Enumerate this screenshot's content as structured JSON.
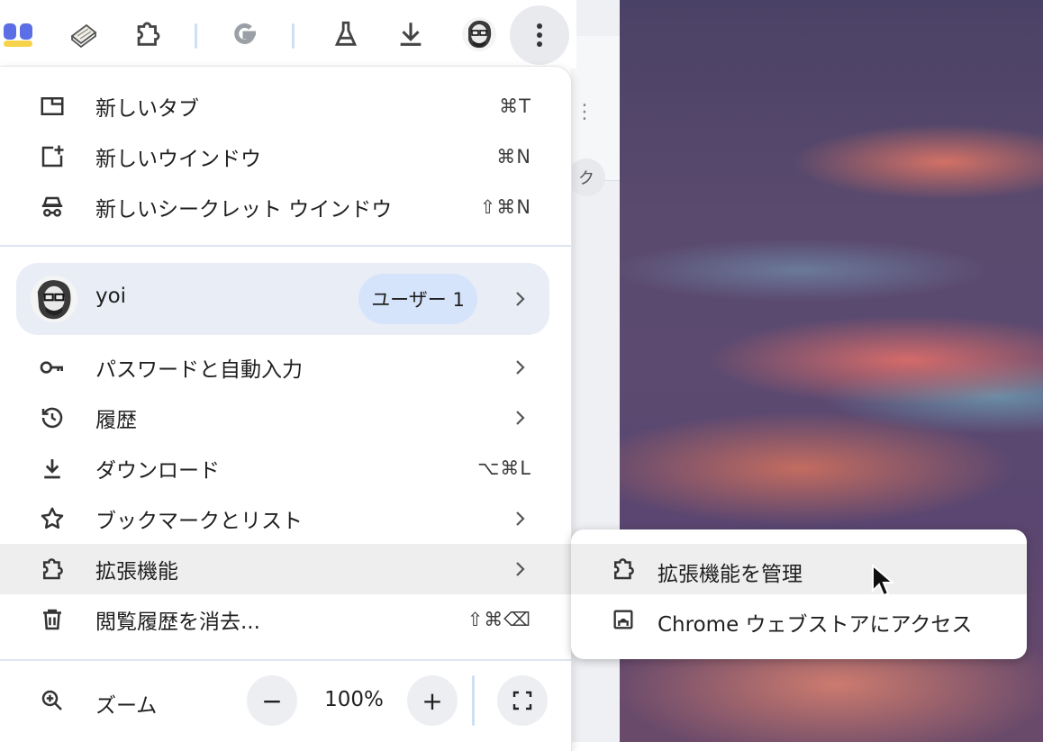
{
  "colors": {
    "accent": "#d5e4fb",
    "profile_bg": "#e9edf6",
    "highlight": "#eeeeee",
    "divider": "#dde5f0"
  },
  "background_strip": {
    "partial_text": "ク"
  },
  "toolbar": {
    "icons": [
      "extension-icon-blue",
      "extension-icon-notebook",
      "extensions-puzzle-icon",
      "google-g-icon",
      "labs-flask-icon",
      "downloads-icon",
      "profile-avatar-icon",
      "more-vert-icon"
    ]
  },
  "menu": {
    "new_tab": {
      "label": "新しいタブ",
      "shortcut": "⌘T",
      "icon": "new-tab-icon"
    },
    "new_window": {
      "label": "新しいウインドウ",
      "shortcut": "⌘N",
      "icon": "new-window-icon"
    },
    "new_incognito": {
      "label": "新しいシークレット ウインドウ",
      "shortcut": "⇧⌘N",
      "icon": "incognito-icon"
    },
    "profile": {
      "name": "yoi",
      "badge": "ユーザー 1"
    },
    "passwords": {
      "label": "パスワードと自動入力",
      "icon": "key-icon"
    },
    "history": {
      "label": "履歴",
      "icon": "history-icon"
    },
    "downloads": {
      "label": "ダウンロード",
      "shortcut": "⌥⌘L",
      "icon": "download-icon"
    },
    "bookmarks": {
      "label": "ブックマークとリスト",
      "icon": "star-icon"
    },
    "extensions": {
      "label": "拡張機能",
      "icon": "puzzle-icon"
    },
    "clear_history": {
      "label": "閲覧履歴を消去...",
      "shortcut": "⇧⌘⌫",
      "icon": "trash-icon"
    },
    "zoom": {
      "label": "ズーム",
      "minus": "−",
      "value": "100%",
      "plus": "+"
    }
  },
  "submenu": {
    "manage_extensions": "拡張機能を管理",
    "web_store": "Chrome ウェブストアにアクセス"
  }
}
